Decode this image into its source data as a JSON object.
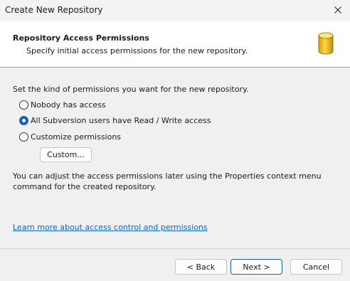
{
  "window": {
    "title": "Create New Repository"
  },
  "header": {
    "title": "Repository Access Permissions",
    "subtitle": "Specify initial access permissions for the new repository.",
    "icon": "database-icon"
  },
  "content": {
    "intro": "Set the kind of permissions you want for the new repository.",
    "options": [
      {
        "label": "Nobody has access",
        "checked": false
      },
      {
        "label": "All Subversion users have Read / Write access",
        "checked": true
      },
      {
        "label": "Customize permissions",
        "checked": false
      }
    ],
    "custom_button": "Custom...",
    "note": "You can adjust the access permissions later using the Properties context menu command for the created repository.",
    "learn_link": "Learn more about access control and permissions"
  },
  "footer": {
    "back": "< Back",
    "next": "Next >",
    "cancel": "Cancel"
  }
}
